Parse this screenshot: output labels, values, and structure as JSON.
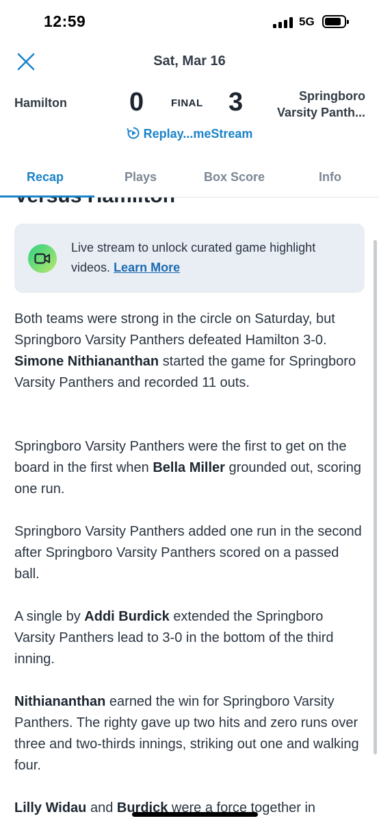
{
  "status_bar": {
    "time": "12:59",
    "network": "5G"
  },
  "header": {
    "date": "Sat, Mar 16",
    "home_team": "Hamilton",
    "home_score": "0",
    "game_status": "FINAL",
    "away_score": "3",
    "away_team_line1": "Springboro",
    "away_team_line2": "Varsity Panth...",
    "replay_label": "Replay...meStream",
    "close_icon": "close-icon",
    "replay_icon": "replay-icon"
  },
  "tabs": [
    {
      "label": "Recap",
      "active": true
    },
    {
      "label": "Plays",
      "active": false
    },
    {
      "label": "Box Score",
      "active": false
    },
    {
      "label": "Info",
      "active": false
    }
  ],
  "article": {
    "heading_fragment": "Versus Hamilton",
    "promo": {
      "text": "Live stream to unlock curated game highlight videos.",
      "link": "Learn More",
      "icon": "video-camera-icon"
    },
    "p1": {
      "t1": "Both teams were strong in the circle on Saturday, but Springboro Varsity Panthers defeated Hamilton 3-0.",
      "b1": "Simone Nithiananthan",
      "t2": "started the game for Springboro Varsity Panthers and recorded 11 outs."
    },
    "p2": {
      "t1": "Springboro Varsity Panthers were the first to get on the board in the first when",
      "b1": "Bella Miller",
      "t2": "grounded out, scoring one run."
    },
    "p3": {
      "t1": "Springboro Varsity Panthers added one run in the second after Springboro Varsity Panthers scored on a passed ball."
    },
    "p4": {
      "t1": "A single by",
      "b1": "Addi Burdick",
      "t2": "extended the Springboro Varsity Panthers lead to 3-0 in the bottom of the third inning."
    },
    "p5": {
      "b1": "Nithiananthan",
      "t1": "earned the win for Springboro Varsity Panthers. The righty gave up two hits and zero runs over three and two-thirds innings, striking out one and walking four."
    },
    "p6": {
      "b1": "Lilly Widau",
      "t1": "and",
      "b2": "Burdick",
      "t2": "were a force together in"
    }
  },
  "colors": {
    "accent": "#1a83c9",
    "promo_bg": "#e9eef4",
    "text": "#2a3441"
  }
}
